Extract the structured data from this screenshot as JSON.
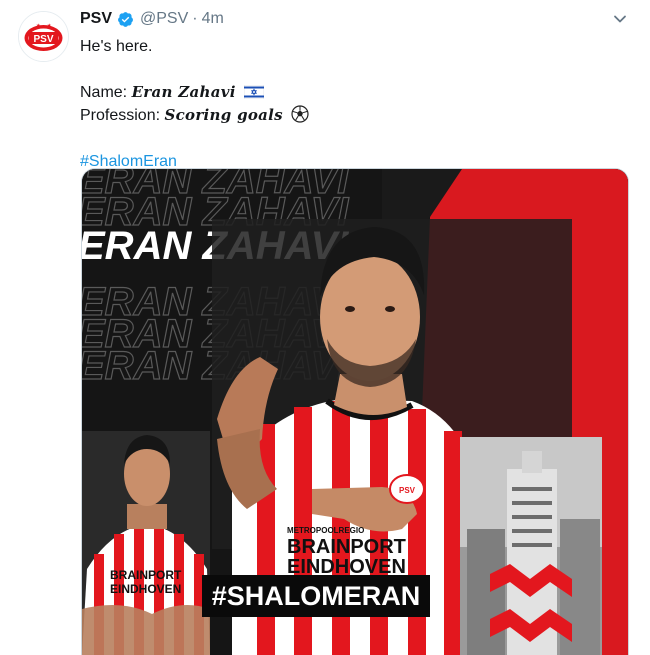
{
  "tweet": {
    "author_name": "PSV",
    "author_handle": "@PSV",
    "separator": "·",
    "timestamp": "4m",
    "lines": {
      "l1": "He's here.",
      "name_label": "Name: ",
      "name_value": "Eran Zahavi",
      "profession_label": "Profession: ",
      "profession_value": "Scoring goals",
      "hashtag": "#ShalomEran"
    }
  },
  "avatar_logo_text": "PSV",
  "media": {
    "repeated_name": "ERAN ZAHAVI",
    "highlight_name": "ERAN ZAHAVI",
    "banner": "#SHALOMERAN",
    "shirt_sponsor_1": "BRAINPORT",
    "shirt_sponsor_2": "EINDHOVEN",
    "shirt_small": "METROPOOLREGIO"
  },
  "colors": {
    "psv_red": "#e3171e",
    "link_blue": "#1b95e0",
    "verified_blue": "#1da1f2",
    "muted_gray": "#657786"
  },
  "icons": {
    "verified": "verified-badge-icon",
    "chevron": "chevron-down-icon",
    "flag": "israel-flag-icon",
    "ball": "soccer-ball-icon"
  }
}
